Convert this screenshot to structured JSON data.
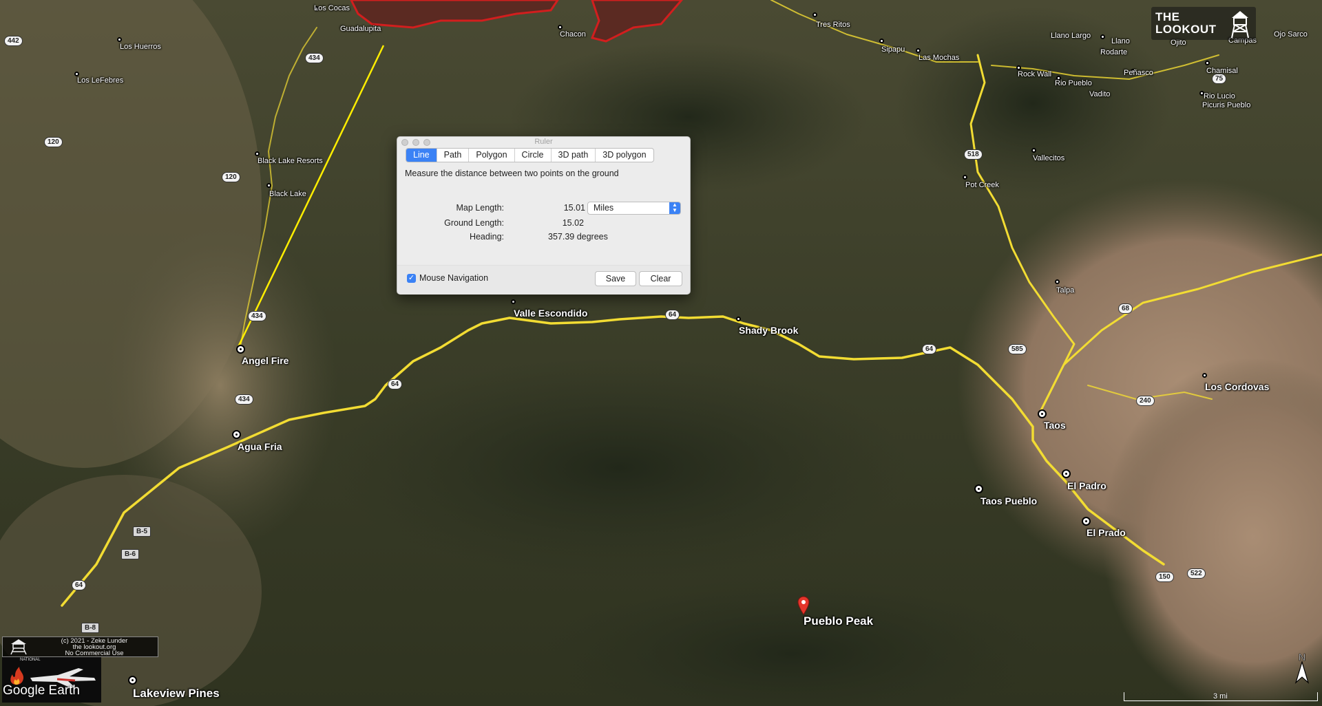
{
  "ruler": {
    "window_title": "Ruler",
    "tabs": [
      "Line",
      "Path",
      "Polygon",
      "Circle",
      "3D path",
      "3D polygon"
    ],
    "active_tab": "Line",
    "description": "Measure the distance between two points on the ground",
    "map_length_label": "Map Length:",
    "map_length_value": "15.01",
    "units": "Miles",
    "ground_length_label": "Ground Length:",
    "ground_length_value": "15.02",
    "heading_label": "Heading:",
    "heading_value": "357.39 degrees",
    "mouse_navigation_label": "Mouse Navigation",
    "mouse_navigation_checked": true,
    "save_label": "Save",
    "clear_label": "Clear"
  },
  "places": {
    "los_cocas": "Los Cocas",
    "guadalupita": "Guadalupita",
    "chacon": "Chacon",
    "los_huerros": "Los Huerros",
    "los_lefebres": "Los LeFebres",
    "black_lake_resorts": "Black Lake Resorts",
    "black_lake": "Black Lake",
    "angel_fire": "Angel Fire",
    "agua_fria": "Agua Fria",
    "valle_escondido": "Valle Escondido",
    "shady_brook": "Shady Brook",
    "tres_ritos": "Tres Ritos",
    "sipapu": "Sipapu",
    "las_mochas": "Las Mochas",
    "llano_largo": "Llano Largo",
    "llano": "Llano",
    "rodarte": "Rodarte",
    "ojito": "Ojito",
    "campas": "Campas",
    "ojo_sarco": "Ojo Sarco",
    "penasco": "Peñasco",
    "chamisal": "Chamisal",
    "rock_wall": "Rock Wall",
    "rio_pueblo": "Rio Pueblo",
    "vadito": "Vadito",
    "rio_lucio": "Rio Lucio",
    "picuris_pueblo": "Picuris Pueblo",
    "vallecitos": "Vallecitos",
    "pot_creek": "Pot Creek",
    "talpa": "Talpa",
    "los_cordovas": "Los Cordovas",
    "taos": "Taos",
    "el_padro": "El Padro",
    "taos_pueblo": "Taos Pueblo",
    "el_prado": "El Prado",
    "pueblo_peak": "Pueblo Peak",
    "lakeview_pines": "Lakeview Pines"
  },
  "roads": {
    "r442": "442",
    "r434a": "434",
    "r120a": "120",
    "r120b": "120",
    "r434b": "434",
    "r434c": "434",
    "r64a": "64",
    "r64b": "64",
    "r64c": "64",
    "r64d": "64",
    "r518": "518",
    "r585": "585",
    "r68": "68",
    "r240": "240",
    "r150": "150",
    "r522": "522",
    "r75": "75",
    "b5": "B-5",
    "b6": "B-6",
    "b8": "B-8"
  },
  "overlay": {
    "logo_line1": "THE",
    "logo_line2": "LOOKOUT",
    "credit_line1": "(c) 2021 - Zeke Lunder",
    "credit_line2": "the lookout.org",
    "credit_line3": "No Commercial Use",
    "national_label": "NATIONAL",
    "google_earth": "Google Earth",
    "scale": "3 mi",
    "compass_letter": "N"
  },
  "colors": {
    "road": "#f2dc33",
    "measure_line": "#ffee00",
    "fire_perimeter": "#d21e1e",
    "tab_active": "#3b82f5"
  }
}
